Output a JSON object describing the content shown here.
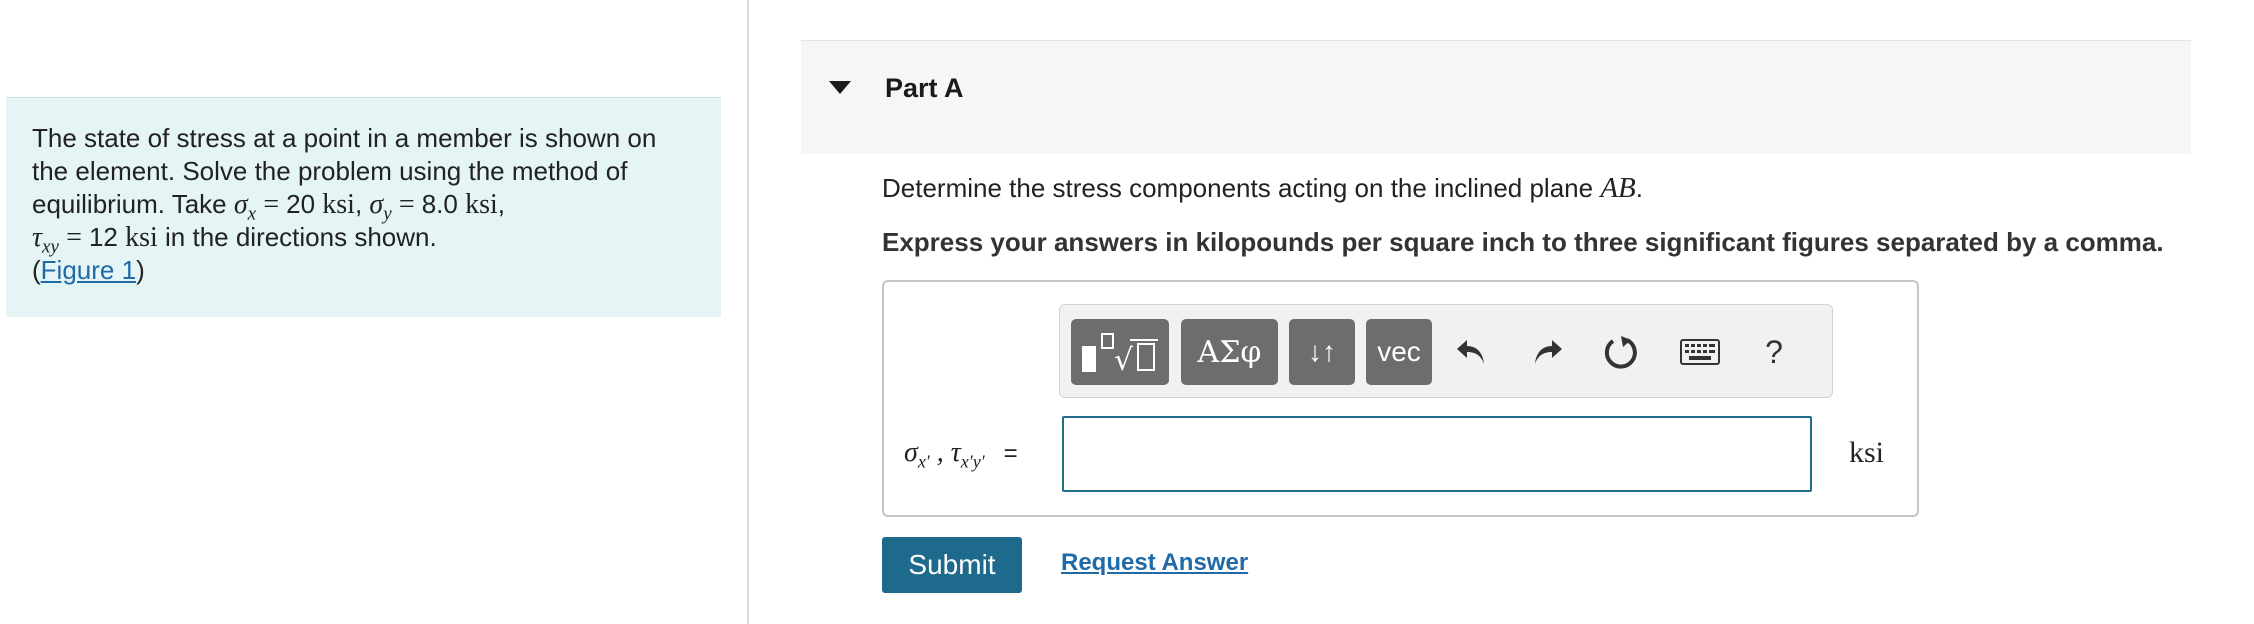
{
  "problem": {
    "line1": "The state of stress at a point in a member is shown on",
    "line2": "the element. Solve the problem using the method of",
    "line3_prefix": "equilibrium. Take ",
    "sigma_x_value": "20",
    "sigma_y_value": "8.0",
    "tau_xy_value": "12",
    "unit": "ksi",
    "line4_suffix": " in the directions shown.",
    "figure_link": "Figure 1"
  },
  "part": {
    "title": "Part A"
  },
  "question": {
    "text": "Determine the stress components acting on the inclined plane ",
    "plane": "AB",
    "instruction": "Express your answers in kilopounds per square inch to three significant figures separated by a comma."
  },
  "toolbar": {
    "greek_label": "ΑΣφ",
    "arrows_label": "↓↑",
    "vec_label": "vec",
    "help_label": "?"
  },
  "answer": {
    "equals": "=",
    "value": "",
    "unit": "ksi"
  },
  "actions": {
    "submit_label": "Submit",
    "request_label": "Request Answer"
  },
  "colors": {
    "accent": "#1e6a8d",
    "link": "#1f6aa7",
    "problem_bg": "#e5f4f4",
    "toolbar_button": "#6d6d6d"
  }
}
